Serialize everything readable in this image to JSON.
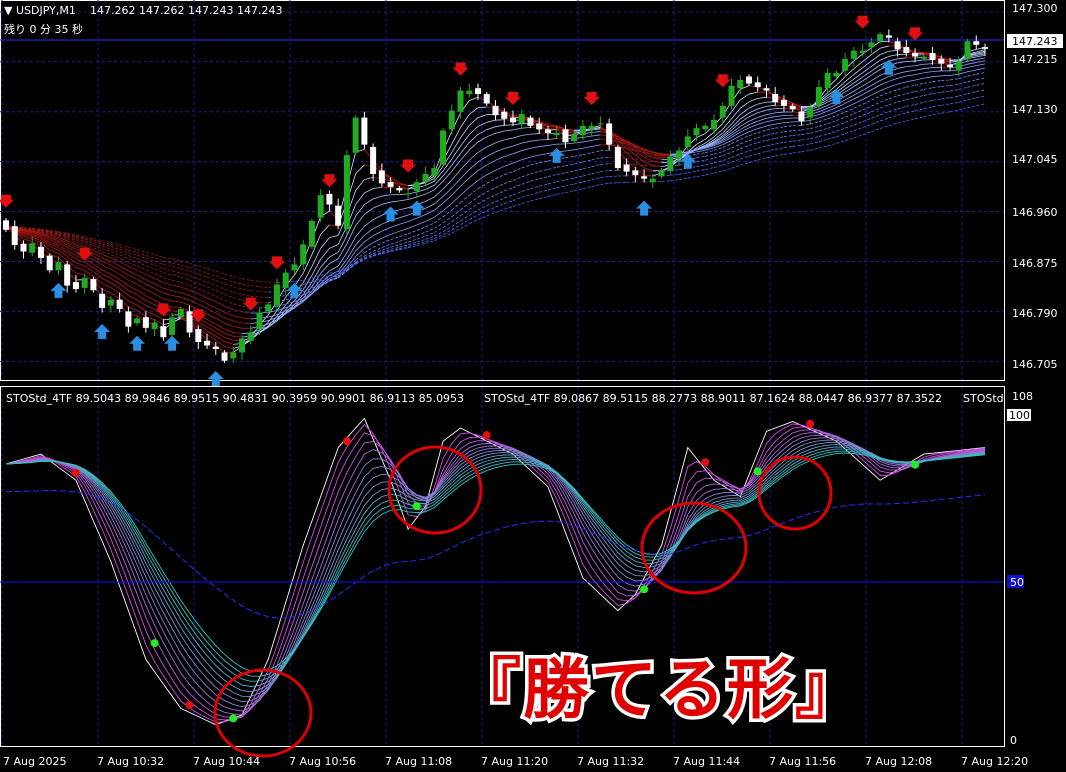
{
  "header": {
    "symbol": "USDJPY,M1",
    "ohlc": "147.262 147.262 147.243 147.243",
    "remaining": "残り 0 分 35 秒"
  },
  "price_axis": {
    "ticks": [
      "147.300",
      "147.215",
      "147.130",
      "147.045",
      "146.960",
      "146.875",
      "146.790",
      "146.705"
    ],
    "current_price": "147.243"
  },
  "indicator": {
    "label1": "STOStd_4TF 89.5043 89.9846 89.9515 90.4831 90.3959 90.9901 86.9113 85.0953",
    "label2": "STOStd_4TF 89.0867 89.5115 88.2773 88.9011 87.1624 88.0447 86.9377 87.3522",
    "label3": "STOStd",
    "axis_ticks": [
      "108",
      "100",
      "50",
      "0"
    ]
  },
  "time_axis": {
    "labels": [
      "7 Aug 2025",
      "7 Aug 10:32",
      "7 Aug 10:44",
      "7 Aug 10:56",
      "7 Aug 11:08",
      "7 Aug 11:20",
      "7 Aug 11:32",
      "7 Aug 11:44",
      "7 Aug 11:56",
      "7 Aug 12:08",
      "7 Aug 12:20"
    ]
  },
  "caption": "『勝てる形』",
  "colors": {
    "background": "#000000",
    "grid": "#1f1f8f",
    "bull": "#22aa22",
    "bear": "#ffffff",
    "sell_arrow": "#e01010",
    "buy_arrow": "#2a8fe0",
    "circle": "#e00000",
    "caption_fill": "#e00000",
    "level50": "#1010ff"
  },
  "chart_data": {
    "type": "candlestick",
    "series_name": "USDJPY,M1",
    "ylim": [
      146.68,
      147.31
    ],
    "price_path": [
      146.935,
      146.905,
      146.89,
      146.9,
      146.885,
      146.86,
      146.87,
      146.84,
      146.83,
      146.845,
      146.82,
      146.8,
      146.81,
      146.79,
      146.77,
      146.78,
      146.76,
      146.765,
      146.75,
      146.78,
      146.79,
      146.76,
      146.74,
      146.73,
      146.72,
      146.71,
      146.72,
      146.74,
      146.76,
      146.79,
      146.8,
      146.83,
      146.86,
      146.87,
      146.9,
      146.95,
      146.99,
      146.97,
      146.93,
      147.06,
      147.12,
      147.07,
      147.03,
      147.01,
      147.0,
      146.99,
      146.995,
      147.01,
      147.02,
      147.04,
      147.1,
      147.13,
      147.16,
      147.17,
      147.16,
      147.14,
      147.13,
      147.12,
      147.11,
      147.12,
      147.11,
      147.1,
      147.09,
      147.1,
      147.08,
      147.09,
      147.1,
      147.11,
      147.11,
      147.07,
      147.04,
      147.03,
      147.02,
      147.01,
      147.02,
      147.03,
      147.05,
      147.07,
      147.09,
      147.1,
      147.1,
      147.12,
      147.14,
      147.17,
      147.19,
      147.18,
      147.17,
      147.16,
      147.15,
      147.14,
      147.13,
      147.12,
      147.14,
      147.17,
      147.19,
      147.2,
      147.22,
      147.23,
      147.24,
      147.25,
      147.26,
      147.25,
      147.24,
      147.23,
      147.22,
      147.23,
      147.22,
      147.21,
      147.2,
      147.22,
      147.25,
      147.24,
      147.243
    ]
  }
}
